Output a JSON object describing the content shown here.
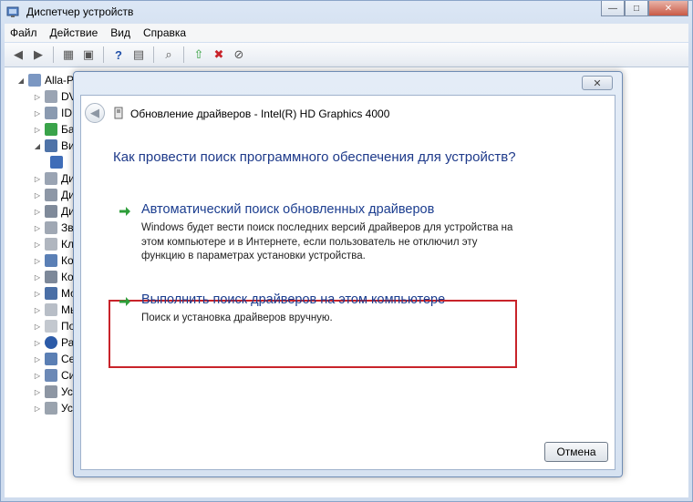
{
  "window": {
    "title": "Диспетчер устройств",
    "controls": {
      "minimize": "—",
      "maximize": "□",
      "close": "✕"
    }
  },
  "menu": [
    "Файл",
    "Действие",
    "Вид",
    "Справка"
  ],
  "tree": {
    "root": "Alla-P",
    "items": [
      "DV",
      "ID",
      "Ба",
      "Ви",
      "",
      "Ди",
      "Ди",
      "Ди",
      "Зв",
      "Кл",
      "Ко",
      "Ко",
      "Мо",
      "Мы",
      "По",
      "Ра",
      "Се",
      "Си",
      "Ус",
      "Ус"
    ]
  },
  "dialog": {
    "close_glyph": "✕",
    "header_title": "Обновление драйверов - Intel(R) HD Graphics 4000",
    "question": "Как провести поиск программного обеспечения для устройств?",
    "options": [
      {
        "title": "Автоматический поиск обновленных драйверов",
        "description": "Windows будет вести поиск последних версий драйверов для устройства на\nэтом компьютере и в Интернете, если пользователь не отключил эту\nфункцию в параметрах установки устройства."
      },
      {
        "title": "Выполнить поиск драйверов на этом компьютере",
        "description": "Поиск и установка драйверов вручную."
      }
    ],
    "cancel_label": "Отмена"
  },
  "colors": {
    "accent_green": "#2e9e3a",
    "highlight_red": "#c8232a",
    "question_blue": "#1e3a8a"
  }
}
